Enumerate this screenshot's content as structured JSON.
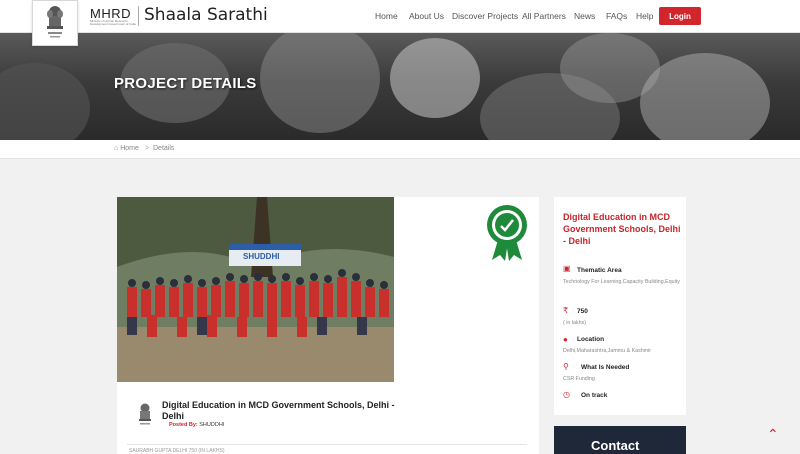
{
  "header": {
    "logo_text": "MHRD",
    "logo_subtext": "Ministry of Human Resource Development Government of India",
    "site_name": "Shaala Sarathi",
    "nav": [
      "Home",
      "About Us",
      "Discover Projects",
      "All Partners",
      "News",
      "FAQs",
      "Help"
    ],
    "login_label": "Login"
  },
  "hero": {
    "title": "PROJECT DETAILS"
  },
  "breadcrumb": {
    "home": "Home",
    "separator": ">",
    "current": "Details"
  },
  "project": {
    "photo_banner_text": "SHUDDHI",
    "title": "Digital Education in MCD Government Schools, Delhi - Delhi",
    "posted_label": "Posted By:",
    "posted_by": "SHUDDHI",
    "meta": "SAURABH GUPTA   DELHI   750 (IN LAKHS)"
  },
  "sidebar": {
    "title": "Digital Education in MCD Government Schools, Delhi - Delhi",
    "thematic_label": "Thematic Area",
    "thematic_value": "Technology For Learning,Capacity Building,Equity",
    "amount_value": "750",
    "amount_unit": "( in lakhs)",
    "location_label": "Location",
    "location_value": "Delhi,Maharashtra,Jammu & Kashmir",
    "need_label": "What Is Needed",
    "need_value": "CSR Funding",
    "status_label": "On track"
  },
  "contact": {
    "label": "Contact"
  },
  "colors": {
    "accent": "#d1262b",
    "badge_green": "#1e8a3a",
    "dark_card": "#1f2838"
  },
  "icons": [
    "emblem-icon",
    "home-icon",
    "chart-icon",
    "rupee-icon",
    "location-pin-icon",
    "search-icon",
    "clock-icon",
    "chevron-up-icon",
    "award-badge-icon"
  ]
}
